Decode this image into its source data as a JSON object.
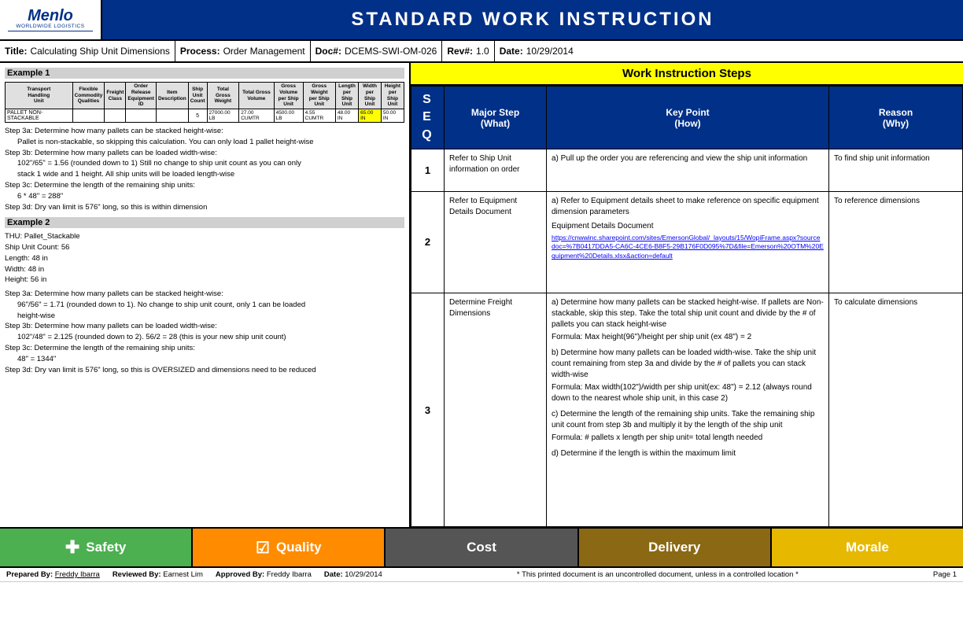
{
  "header": {
    "logo_name": "Menlo",
    "logo_sub": "WORLDWIDE LOGISTICS",
    "title": "STANDARD WORK INSTRUCTION"
  },
  "info_row": {
    "title_label": "Title:",
    "title_value": "Calculating Ship Unit Dimensions",
    "process_label": "Process:",
    "process_value": "Order Management",
    "doc_label": "Doc#:",
    "doc_value": "DCEMS-SWI-OM-026",
    "rev_label": "Rev#:",
    "rev_value": "1.0",
    "date_label": "Date:",
    "date_value": "10/29/2014"
  },
  "left_panel": {
    "example1_title": "Example 1",
    "table_headers": [
      "Transport Handling Unit",
      "Flexible Commodity Qualities",
      "Freight Class",
      "Order Release Equipment ID",
      "Item Description",
      "Ship Unit Count",
      "Total Gross Weight",
      "Total Gross Volume",
      "Gross Volume per Ship Unit",
      "Gross Weight per Ship Unit",
      "Length per Ship Unit",
      "Width per Ship Unit",
      "Height per Ship Unit"
    ],
    "table_row": [
      "PALLET NON-STACKABLE",
      "",
      "",
      "",
      "",
      "5",
      "27000.00 LB",
      "27.00 CUMTR",
      "4500.00 LB",
      "4.55 CUMTR",
      "48.00 IN",
      "65.00 IN",
      "50.00 IN"
    ],
    "steps_example1": [
      "Step 3a: Determine how many pallets can be stacked height-wise:",
      "    Pallet is non-stackable, so skipping this calculation. You can only load 1 pallet height-wise",
      "Step 3b: Determine how many pallets can be loaded width-wise:",
      "    102\"/65\" = 1.56 (rounded down to 1) Still no change to ship unit count as you can only",
      "    stack 1 wide and 1 height. All ship units will be loaded length-wise",
      "Step 3c: Determine the length of the remaining ship units:",
      "    6 * 48\" = 288\"",
      "Step 3d: Dry van limit is 576\" long, so this is within dimension"
    ],
    "example2_title": "Example 2",
    "example2_info": [
      "THU: Pallet_Stackable",
      "Ship Unit Count: 56",
      "Length: 48 in",
      "Width: 48 in",
      "Height: 56 in"
    ],
    "steps_example2": [
      "Step 3a: Determine how many pallets can be stacked height-wise:",
      "    96\"/56\" = 1.71 (rounded down to 1). No change to ship unit count, only 1 can be loaded",
      "    height-wise",
      "Step 3b: Determine how many pallets can be loaded width-wise:",
      "    102\"/48\" = 2.125 (rounded down to 2). 56/2 = 28 (this is your new ship unit count)",
      "Step 3c: Determine the length of the remaining ship units:",
      "    48\" = 1344\"",
      "Step 3d: Dry van limit is 576\" long, so this is OVERSIZED and dimensions need to be reduced"
    ]
  },
  "right_panel": {
    "wi_header": "Work Instruction Steps",
    "seq_header": "S\nE\nQ",
    "major_header": "Major Step\n(What)",
    "key_header": "Key Point\n(How)",
    "reason_header": "Reason\n(Why)",
    "steps": [
      {
        "seq": "1",
        "major": "Refer to Ship Unit information on order",
        "key_points": [
          "a)  Pull up the order you are referencing and view the ship unit information"
        ],
        "reason": "To find ship unit information"
      },
      {
        "seq": "2",
        "major": "Refer to Equipment Details Document",
        "key_points": [
          "a)  Refer to Equipment details sheet to make reference on specific equipment dimension parameters",
          "Equipment Details Document",
          "https://cnwwinc.sharepoint.com/sites/EmersonGlobal/_layouts/15/WopiFrame.aspx?sourcedoc=%7B0417DDA5-CA6C-4CE6-B8F5-29B176F0D095%7D&file=Emerson%20OTM%20Equipment%20Details.xlsx&action=default"
        ],
        "reason": "To reference dimensions"
      },
      {
        "seq": "3",
        "major": "Determine Freight Dimensions",
        "key_points": [
          "a)  Determine how many pallets can be stacked height-wise. If pallets are Non-stackable, skip this step. Take the total ship unit count and divide by the # of pallets you can stack height-wise",
          "Formula: Max height(96\")/height per ship unit (ex  48\") = 2",
          "",
          "b)  Determine how many pallets can be loaded width-wise. Take the ship unit count remaining from step 3a and divide by the # of pallets you can stack width-wise",
          "Formula: Max width(102\")/width per ship unit(ex: 48\") = 2.12 (always round down to the nearest whole ship unit, in this case 2)",
          "",
          "c)  Determine the length of the remaining ship units. Take the remaining ship unit count from step 3b and multiply it by the length of the ship unit",
          "Formula: # pallets x length per ship unit= total length needed",
          "",
          "d)  Determine if the length is within the maximum limit"
        ],
        "reason": "To calculate dimensions"
      }
    ]
  },
  "footer": {
    "tabs": [
      {
        "label": "Safety",
        "icon": "✚",
        "class": "tab-safety"
      },
      {
        "label": "Quality",
        "icon": "☑",
        "class": "tab-quality"
      },
      {
        "label": "Cost",
        "icon": "",
        "class": "tab-cost"
      },
      {
        "label": "Delivery",
        "icon": "",
        "class": "tab-delivery"
      },
      {
        "label": "Morale",
        "icon": "",
        "class": "tab-morale"
      }
    ],
    "prepared_label": "Prepared By:",
    "prepared_by": "Freddy Ibarra",
    "reviewed_label": "Reviewed By:",
    "reviewed_by": "Earnest Lim",
    "approved_label": "Approved By:",
    "approved_by": "Freddy Ibarra",
    "date_label": "Date:",
    "date_value": "10/29/2014",
    "disclaimer": "* This printed document is an uncontrolled document, unless in a controlled location *",
    "page": "Page 1"
  }
}
